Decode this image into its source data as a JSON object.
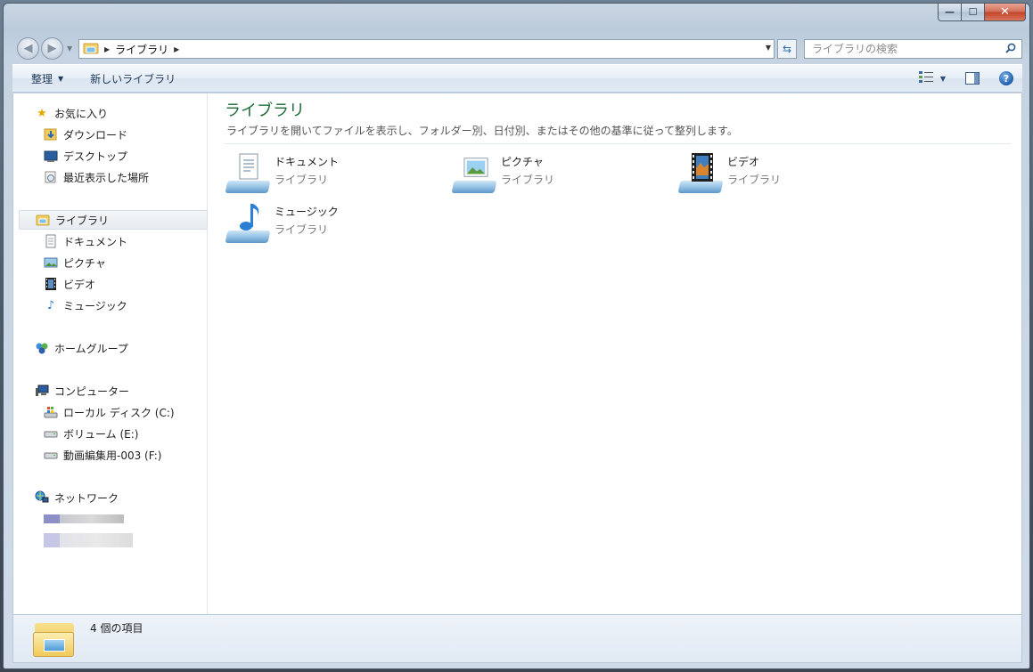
{
  "window": {
    "caption": {
      "minimize": "—",
      "maximize": "☐",
      "close": "✕"
    }
  },
  "navbar": {
    "back_icon": "back-arrow-icon",
    "forward_icon": "forward-arrow-icon",
    "breadcrumb": [
      "ライブラリ"
    ],
    "search_placeholder": "ライブラリの検索"
  },
  "commandbar": {
    "organize_label": "整理",
    "new_library_label": "新しいライブラリ"
  },
  "sidebar": {
    "favorites": {
      "label": "お気に入り",
      "items": [
        "ダウンロード",
        "デスクトップ",
        "最近表示した場所"
      ]
    },
    "libraries": {
      "label": "ライブラリ",
      "items": [
        "ドキュメント",
        "ピクチャ",
        "ビデオ",
        "ミュージック"
      ]
    },
    "homegroup": {
      "label": "ホームグループ"
    },
    "computer": {
      "label": "コンピューター",
      "items": [
        "ローカル ディスク (C:)",
        "ボリューム (E:)",
        "動画編集用-003 (F:)"
      ]
    },
    "network": {
      "label": "ネットワーク"
    }
  },
  "main": {
    "title": "ライブラリ",
    "description": "ライブラリを開いてファイルを表示し、フォルダー別、日付別、またはその他の基準に従って整列します。",
    "tiles": [
      {
        "name": "ドキュメント",
        "sub": "ライブラリ",
        "icon": "documents-library-icon"
      },
      {
        "name": "ピクチャ",
        "sub": "ライブラリ",
        "icon": "pictures-library-icon"
      },
      {
        "name": "ビデオ",
        "sub": "ライブラリ",
        "icon": "videos-library-icon"
      },
      {
        "name": "ミュージック",
        "sub": "ライブラリ",
        "icon": "music-library-icon"
      }
    ]
  },
  "statusbar": {
    "item_count": "4 個の項目"
  },
  "colors": {
    "accent_title": "#1e6b38",
    "command_text": "#1e395b",
    "selected_bg": "#e8ecf0"
  }
}
